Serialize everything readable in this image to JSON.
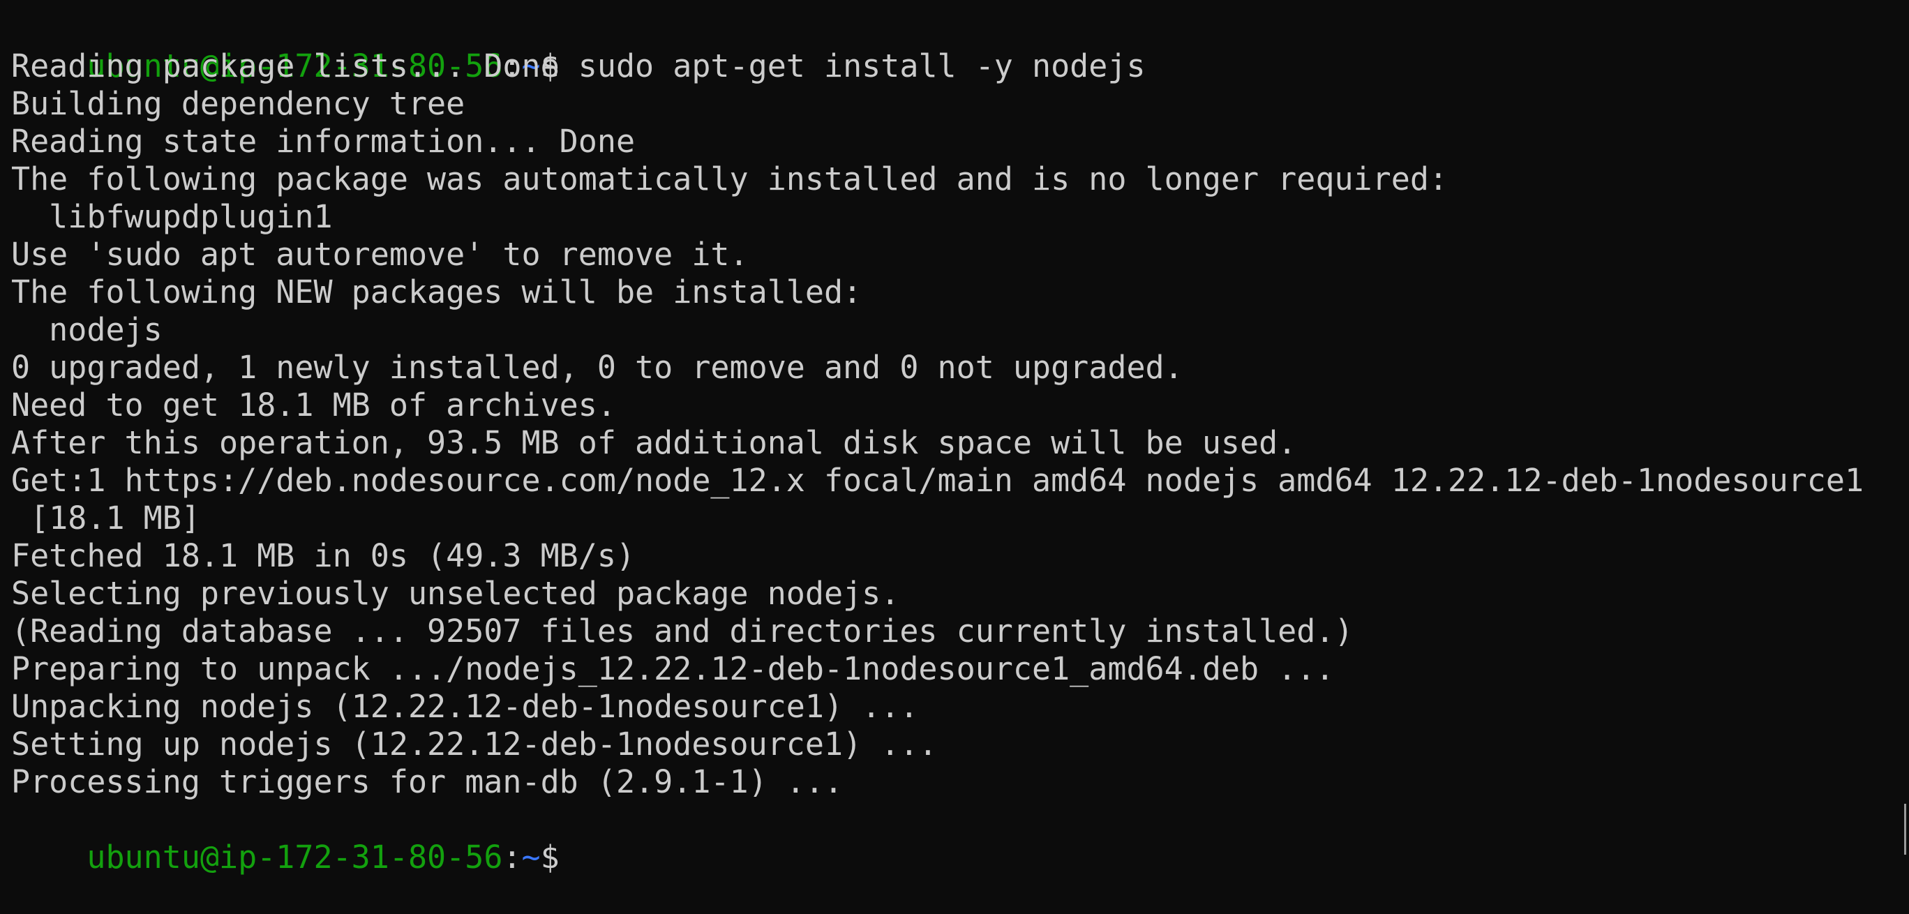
{
  "terminal": {
    "prompt": {
      "user_host": "ubuntu@ip-172-31-80-56",
      "separator": ":",
      "path": "~",
      "symbol": "$ "
    },
    "command": "sudo apt-get install -y nodejs",
    "output": [
      "Reading package lists... Done",
      "Building dependency tree",
      "Reading state information... Done",
      "The following package was automatically installed and is no longer required:",
      "  libfwupdplugin1",
      "Use 'sudo apt autoremove' to remove it.",
      "The following NEW packages will be installed:",
      "  nodejs",
      "0 upgraded, 1 newly installed, 0 to remove and 0 not upgraded.",
      "Need to get 18.1 MB of archives.",
      "After this operation, 93.5 MB of additional disk space will be used.",
      "Get:1 https://deb.nodesource.com/node_12.x focal/main amd64 nodejs amd64 12.22.12-deb-1nodesource1",
      " [18.1 MB]",
      "Fetched 18.1 MB in 0s (49.3 MB/s)",
      "Selecting previously unselected package nodejs.",
      "(Reading database ... 92507 files and directories currently installed.)",
      "Preparing to unpack .../nodejs_12.22.12-deb-1nodesource1_amd64.deb ...",
      "Unpacking nodejs (12.22.12-deb-1nodesource1) ...",
      "Setting up nodejs (12.22.12-deb-1nodesource1) ...",
      "Processing triggers for man-db (2.9.1-1) ..."
    ],
    "colors": {
      "background": "#0c0c0c",
      "text": "#cccccc",
      "prompt_user": "#13a10e",
      "prompt_path": "#3b78ff"
    }
  }
}
